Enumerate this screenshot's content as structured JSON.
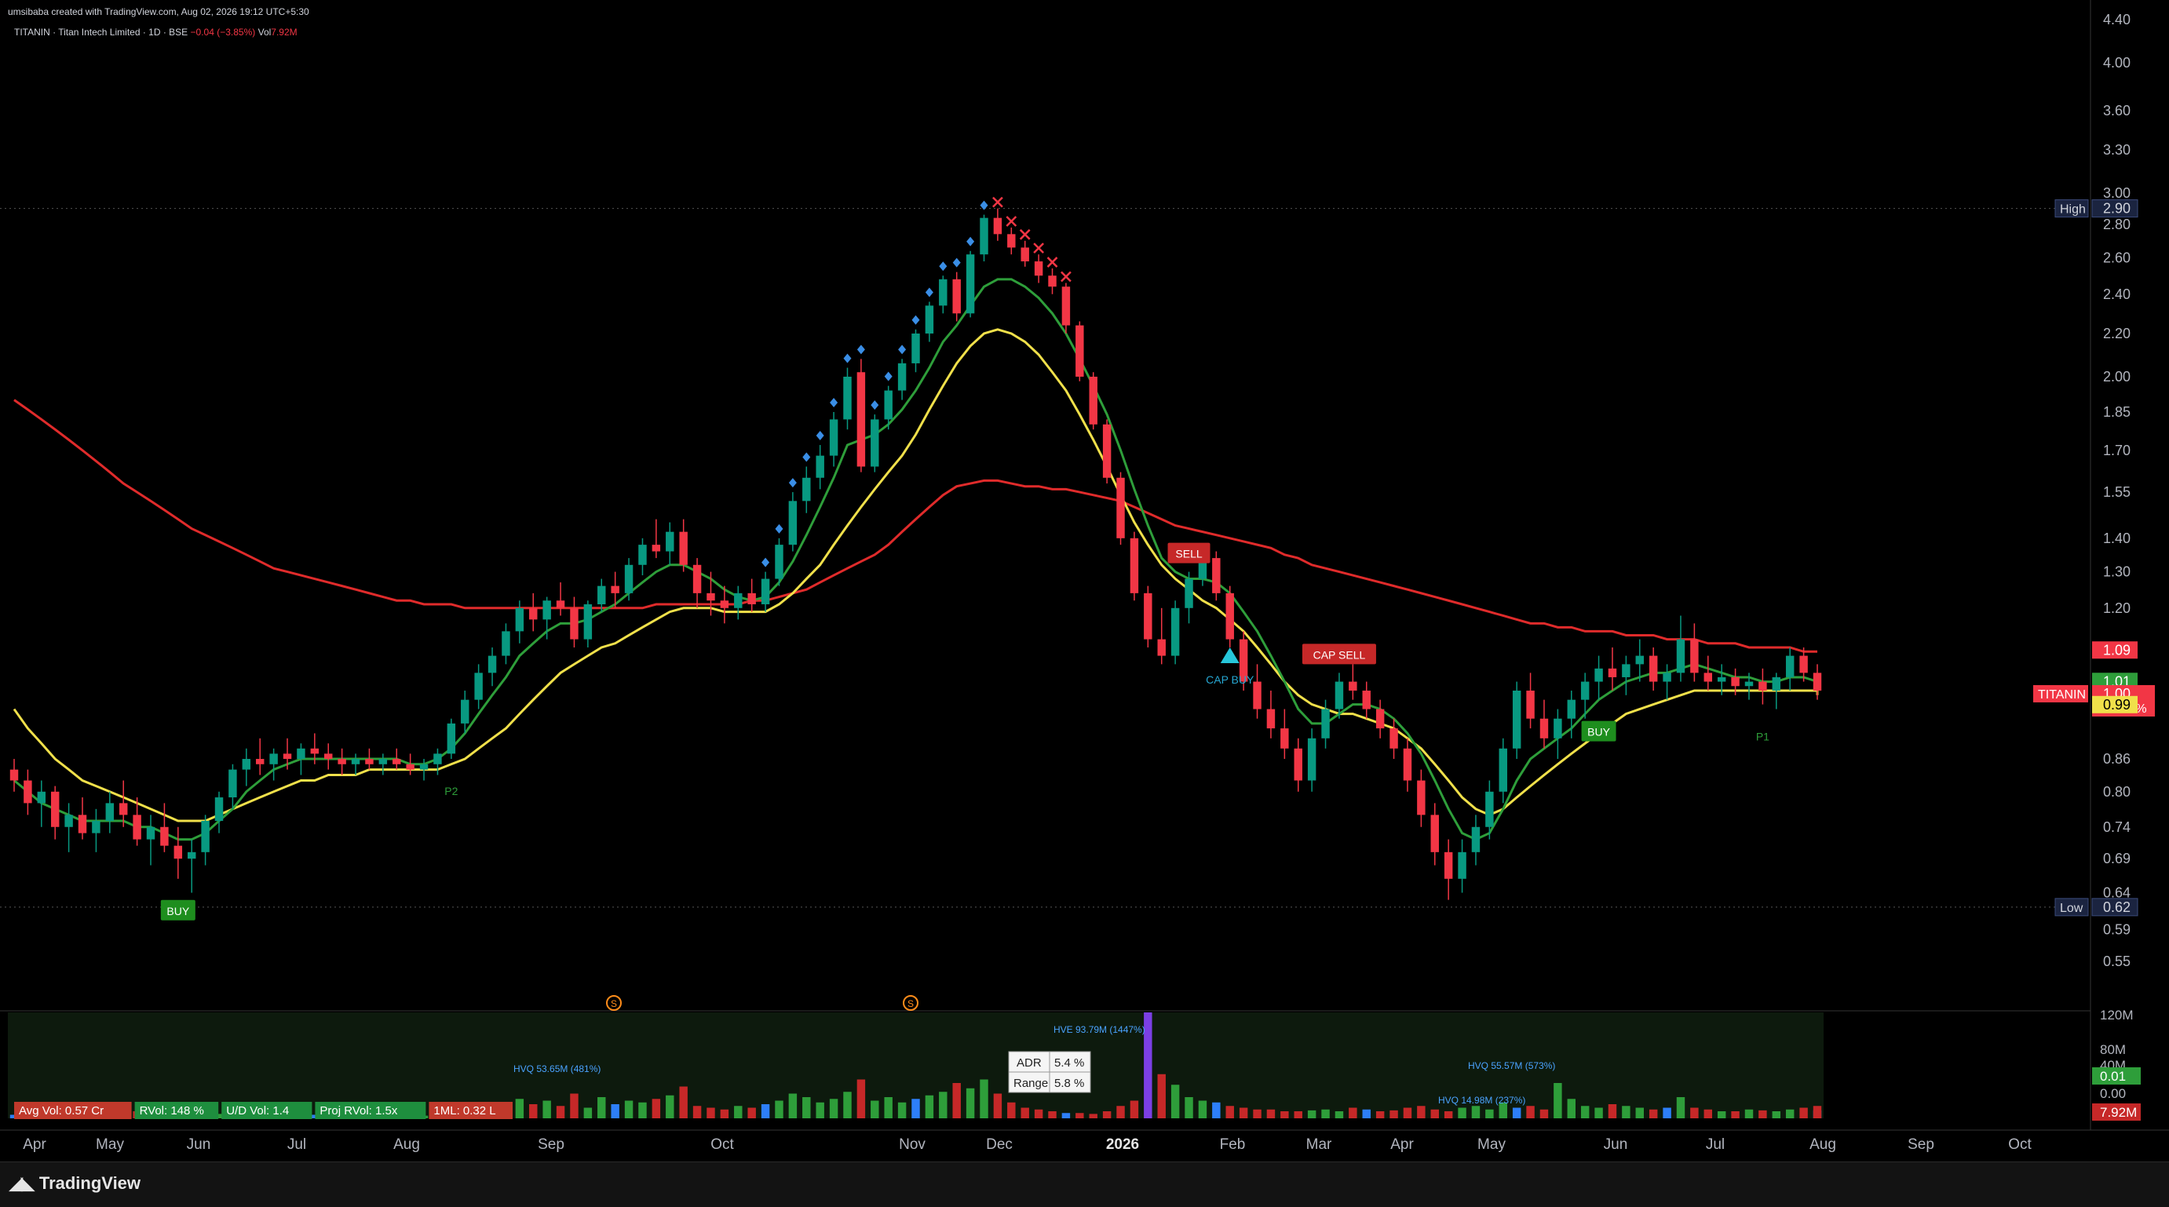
{
  "header": {
    "creator": "umsibaba created with TradingView.com, Aug 02, 2026 19:12 UTC+5:30",
    "symbol_line": "TITANIN · Titan Intech Limited · 1D · BSE",
    "change": "−0.04 (−3.85%)",
    "vol_label": "Vol",
    "vol_value": "7.92M"
  },
  "brand": {
    "name": "TradingView"
  },
  "colors": {
    "background": "#000000",
    "up": "#089981",
    "down": "#f23645",
    "ma_fast": "#2e9e3a",
    "ma_mid": "#f0e04a",
    "ma_slow": "#e02b2b",
    "diamond": "#3a8ee6",
    "price_label": "#f23645"
  },
  "chart_data": {
    "type": "candlestick",
    "symbol": "TITANIN",
    "timeframe": "1D",
    "y_scale": "log",
    "y_range": [
      0.5,
      4.4
    ],
    "y_ticks": [
      "4.40",
      "4.00",
      "3.60",
      "3.30",
      "3.00",
      "2.80",
      "2.60",
      "2.40",
      "2.20",
      "2.00",
      "1.85",
      "1.70",
      "1.55",
      "1.40",
      "1.30",
      "1.20",
      "1.09",
      "1.01",
      "1.00",
      "0.99",
      "0.86",
      "0.80",
      "0.74",
      "0.69",
      "0.64",
      "0.59",
      "0.55"
    ],
    "x_labels": [
      "Apr",
      "May",
      "Jun",
      "Jul",
      "Aug",
      "Sep",
      "Oct",
      "Nov",
      "Dec",
      "2026",
      "Feb",
      "Mar",
      "Apr",
      "May",
      "Jun",
      "Jul",
      "Aug",
      "Sep",
      "Oct"
    ],
    "high": {
      "label": "High",
      "value": "2.90"
    },
    "low": {
      "label": "Low",
      "value": "0.62"
    },
    "price_labels": [
      {
        "value": "1.09",
        "color": "#f23645"
      },
      {
        "value": "1.01",
        "color": "#2e9e3a"
      },
      {
        "symbol": "TITANIN",
        "value": "1.00",
        "change": "+25.26%",
        "color": "#f23645"
      },
      {
        "value": "0.99",
        "color": "#f0e04a"
      }
    ],
    "candles": [
      [
        0.84,
        0.86,
        0.8,
        0.82
      ],
      [
        0.82,
        0.84,
        0.76,
        0.78
      ],
      [
        0.78,
        0.82,
        0.74,
        0.8
      ],
      [
        0.8,
        0.81,
        0.72,
        0.74
      ],
      [
        0.74,
        0.78,
        0.7,
        0.76
      ],
      [
        0.76,
        0.79,
        0.72,
        0.73
      ],
      [
        0.73,
        0.77,
        0.7,
        0.75
      ],
      [
        0.75,
        0.8,
        0.73,
        0.78
      ],
      [
        0.78,
        0.82,
        0.74,
        0.76
      ],
      [
        0.76,
        0.79,
        0.71,
        0.72
      ],
      [
        0.72,
        0.76,
        0.68,
        0.74
      ],
      [
        0.74,
        0.78,
        0.7,
        0.71
      ],
      [
        0.71,
        0.74,
        0.66,
        0.69
      ],
      [
        0.69,
        0.72,
        0.64,
        0.7
      ],
      [
        0.7,
        0.76,
        0.68,
        0.75
      ],
      [
        0.75,
        0.8,
        0.73,
        0.79
      ],
      [
        0.79,
        0.85,
        0.77,
        0.84
      ],
      [
        0.84,
        0.88,
        0.81,
        0.86
      ],
      [
        0.86,
        0.9,
        0.83,
        0.85
      ],
      [
        0.85,
        0.88,
        0.82,
        0.87
      ],
      [
        0.87,
        0.9,
        0.84,
        0.86
      ],
      [
        0.86,
        0.89,
        0.83,
        0.88
      ],
      [
        0.88,
        0.91,
        0.85,
        0.87
      ],
      [
        0.87,
        0.89,
        0.84,
        0.86
      ],
      [
        0.86,
        0.88,
        0.83,
        0.85
      ],
      [
        0.85,
        0.87,
        0.83,
        0.86
      ],
      [
        0.86,
        0.88,
        0.84,
        0.85
      ],
      [
        0.85,
        0.87,
        0.83,
        0.86
      ],
      [
        0.86,
        0.88,
        0.84,
        0.85
      ],
      [
        0.85,
        0.87,
        0.83,
        0.84
      ],
      [
        0.84,
        0.86,
        0.82,
        0.85
      ],
      [
        0.85,
        0.88,
        0.83,
        0.87
      ],
      [
        0.87,
        0.94,
        0.86,
        0.93
      ],
      [
        0.93,
        1.0,
        0.91,
        0.98
      ],
      [
        0.98,
        1.06,
        0.96,
        1.04
      ],
      [
        1.04,
        1.1,
        1.01,
        1.08
      ],
      [
        1.08,
        1.16,
        1.06,
        1.14
      ],
      [
        1.14,
        1.22,
        1.11,
        1.2
      ],
      [
        1.2,
        1.24,
        1.14,
        1.17
      ],
      [
        1.17,
        1.23,
        1.12,
        1.22
      ],
      [
        1.22,
        1.27,
        1.18,
        1.2
      ],
      [
        1.2,
        1.23,
        1.1,
        1.12
      ],
      [
        1.12,
        1.22,
        1.1,
        1.21
      ],
      [
        1.21,
        1.28,
        1.19,
        1.26
      ],
      [
        1.26,
        1.3,
        1.2,
        1.24
      ],
      [
        1.24,
        1.34,
        1.22,
        1.32
      ],
      [
        1.32,
        1.4,
        1.29,
        1.38
      ],
      [
        1.38,
        1.46,
        1.34,
        1.36
      ],
      [
        1.36,
        1.45,
        1.32,
        1.42
      ],
      [
        1.42,
        1.46,
        1.3,
        1.32
      ],
      [
        1.32,
        1.34,
        1.2,
        1.24
      ],
      [
        1.24,
        1.3,
        1.18,
        1.22
      ],
      [
        1.22,
        1.26,
        1.16,
        1.2
      ],
      [
        1.2,
        1.26,
        1.17,
        1.24
      ],
      [
        1.24,
        1.28,
        1.19,
        1.21
      ],
      [
        1.21,
        1.3,
        1.19,
        1.28
      ],
      [
        1.28,
        1.4,
        1.26,
        1.38
      ],
      [
        1.38,
        1.55,
        1.36,
        1.52
      ],
      [
        1.52,
        1.64,
        1.48,
        1.6
      ],
      [
        1.6,
        1.72,
        1.56,
        1.68
      ],
      [
        1.68,
        1.85,
        1.64,
        1.82
      ],
      [
        1.82,
        2.04,
        1.78,
        2.0
      ],
      [
        2.02,
        2.08,
        1.62,
        1.64
      ],
      [
        1.64,
        1.84,
        1.62,
        1.82
      ],
      [
        1.82,
        1.96,
        1.78,
        1.94
      ],
      [
        1.94,
        2.08,
        1.9,
        2.06
      ],
      [
        2.06,
        2.22,
        2.02,
        2.2
      ],
      [
        2.2,
        2.36,
        2.16,
        2.34
      ],
      [
        2.34,
        2.5,
        2.3,
        2.48
      ],
      [
        2.48,
        2.52,
        2.26,
        2.3
      ],
      [
        2.3,
        2.64,
        2.28,
        2.62
      ],
      [
        2.62,
        2.86,
        2.58,
        2.84
      ],
      [
        2.84,
        2.9,
        2.7,
        2.74
      ],
      [
        2.74,
        2.78,
        2.62,
        2.66
      ],
      [
        2.66,
        2.7,
        2.55,
        2.58
      ],
      [
        2.58,
        2.62,
        2.46,
        2.5
      ],
      [
        2.5,
        2.54,
        2.4,
        2.44
      ],
      [
        2.44,
        2.46,
        2.2,
        2.24
      ],
      [
        2.24,
        2.26,
        1.98,
        2.0
      ],
      [
        2.0,
        2.02,
        1.78,
        1.8
      ],
      [
        1.8,
        1.82,
        1.58,
        1.6
      ],
      [
        1.6,
        1.62,
        1.38,
        1.4
      ],
      [
        1.4,
        1.42,
        1.22,
        1.24
      ],
      [
        1.24,
        1.26,
        1.1,
        1.12
      ],
      [
        1.12,
        1.2,
        1.06,
        1.08
      ],
      [
        1.08,
        1.22,
        1.06,
        1.2
      ],
      [
        1.2,
        1.3,
        1.16,
        1.28
      ],
      [
        1.28,
        1.36,
        1.26,
        1.34
      ],
      [
        1.34,
        1.36,
        1.22,
        1.24
      ],
      [
        1.24,
        1.26,
        1.1,
        1.12
      ],
      [
        1.12,
        1.14,
        1.0,
        1.02
      ],
      [
        1.02,
        1.06,
        0.94,
        0.96
      ],
      [
        0.96,
        1.0,
        0.9,
        0.92
      ],
      [
        0.92,
        0.96,
        0.86,
        0.88
      ],
      [
        0.88,
        0.9,
        0.8,
        0.82
      ],
      [
        0.82,
        0.92,
        0.8,
        0.9
      ],
      [
        0.9,
        0.98,
        0.88,
        0.96
      ],
      [
        0.96,
        1.04,
        0.94,
        1.02
      ],
      [
        1.02,
        1.06,
        0.98,
        1.0
      ],
      [
        1.0,
        1.02,
        0.94,
        0.96
      ],
      [
        0.96,
        0.98,
        0.9,
        0.92
      ],
      [
        0.92,
        0.94,
        0.86,
        0.88
      ],
      [
        0.88,
        0.9,
        0.8,
        0.82
      ],
      [
        0.82,
        0.84,
        0.74,
        0.76
      ],
      [
        0.76,
        0.78,
        0.68,
        0.7
      ],
      [
        0.7,
        0.72,
        0.63,
        0.66
      ],
      [
        0.66,
        0.72,
        0.64,
        0.7
      ],
      [
        0.7,
        0.76,
        0.68,
        0.74
      ],
      [
        0.74,
        0.82,
        0.72,
        0.8
      ],
      [
        0.8,
        0.9,
        0.78,
        0.88
      ],
      [
        0.88,
        1.02,
        0.86,
        1.0
      ],
      [
        1.0,
        1.04,
        0.92,
        0.94
      ],
      [
        0.94,
        0.98,
        0.88,
        0.9
      ],
      [
        0.9,
        0.96,
        0.86,
        0.94
      ],
      [
        0.94,
        1.0,
        0.9,
        0.98
      ],
      [
        0.98,
        1.04,
        0.94,
        1.02
      ],
      [
        1.02,
        1.08,
        0.98,
        1.05
      ],
      [
        1.05,
        1.1,
        1.0,
        1.03
      ],
      [
        1.03,
        1.08,
        0.99,
        1.06
      ],
      [
        1.06,
        1.12,
        1.02,
        1.08
      ],
      [
        1.08,
        1.1,
        1.0,
        1.02
      ],
      [
        1.02,
        1.06,
        0.98,
        1.04
      ],
      [
        1.04,
        1.18,
        1.02,
        1.12
      ],
      [
        1.12,
        1.16,
        1.02,
        1.04
      ],
      [
        1.04,
        1.08,
        1.0,
        1.02
      ],
      [
        1.02,
        1.06,
        0.99,
        1.03
      ],
      [
        1.03,
        1.05,
        0.99,
        1.01
      ],
      [
        1.01,
        1.04,
        0.98,
        1.02
      ],
      [
        1.02,
        1.05,
        0.97,
        1.0
      ],
      [
        1.0,
        1.04,
        0.96,
        1.03
      ],
      [
        1.03,
        1.1,
        1.0,
        1.08
      ],
      [
        1.08,
        1.1,
        1.02,
        1.04
      ],
      [
        1.04,
        1.06,
        0.98,
        1.0
      ]
    ],
    "ma_fast": [
      0.82,
      0.8,
      0.78,
      0.77,
      0.76,
      0.75,
      0.75,
      0.75,
      0.75,
      0.74,
      0.74,
      0.73,
      0.72,
      0.72,
      0.73,
      0.75,
      0.77,
      0.8,
      0.82,
      0.84,
      0.85,
      0.86,
      0.86,
      0.86,
      0.86,
      0.86,
      0.86,
      0.86,
      0.86,
      0.85,
      0.85,
      0.86,
      0.88,
      0.91,
      0.95,
      0.99,
      1.03,
      1.08,
      1.11,
      1.14,
      1.16,
      1.16,
      1.17,
      1.19,
      1.21,
      1.24,
      1.27,
      1.3,
      1.32,
      1.32,
      1.3,
      1.28,
      1.25,
      1.23,
      1.22,
      1.23,
      1.27,
      1.33,
      1.41,
      1.5,
      1.6,
      1.72,
      1.74,
      1.76,
      1.8,
      1.86,
      1.94,
      2.04,
      2.16,
      2.24,
      2.34,
      2.44,
      2.48,
      2.48,
      2.44,
      2.38,
      2.3,
      2.2,
      2.08,
      1.96,
      1.84,
      1.7,
      1.56,
      1.44,
      1.34,
      1.3,
      1.28,
      1.28,
      1.27,
      1.24,
      1.19,
      1.14,
      1.08,
      1.02,
      0.96,
      0.93,
      0.93,
      0.95,
      0.97,
      0.97,
      0.96,
      0.94,
      0.91,
      0.87,
      0.82,
      0.77,
      0.73,
      0.72,
      0.73,
      0.77,
      0.82,
      0.86,
      0.88,
      0.9,
      0.92,
      0.95,
      0.98,
      1.0,
      1.02,
      1.03,
      1.04,
      1.04,
      1.05,
      1.06,
      1.05,
      1.04,
      1.03,
      1.03,
      1.02,
      1.02,
      1.03,
      1.03,
      1.02,
      1.01
    ],
    "ma_mid": [
      0.96,
      0.92,
      0.89,
      0.86,
      0.84,
      0.82,
      0.81,
      0.8,
      0.79,
      0.78,
      0.77,
      0.76,
      0.75,
      0.75,
      0.75,
      0.76,
      0.77,
      0.78,
      0.79,
      0.8,
      0.81,
      0.82,
      0.82,
      0.83,
      0.83,
      0.83,
      0.84,
      0.84,
      0.84,
      0.84,
      0.84,
      0.84,
      0.85,
      0.86,
      0.88,
      0.9,
      0.92,
      0.95,
      0.98,
      1.01,
      1.04,
      1.06,
      1.08,
      1.1,
      1.11,
      1.13,
      1.15,
      1.17,
      1.19,
      1.2,
      1.2,
      1.2,
      1.19,
      1.19,
      1.19,
      1.19,
      1.21,
      1.24,
      1.28,
      1.32,
      1.38,
      1.44,
      1.5,
      1.56,
      1.62,
      1.68,
      1.76,
      1.86,
      1.96,
      2.06,
      2.14,
      2.2,
      2.22,
      2.2,
      2.16,
      2.1,
      2.02,
      1.94,
      1.84,
      1.74,
      1.64,
      1.54,
      1.45,
      1.38,
      1.32,
      1.28,
      1.25,
      1.22,
      1.2,
      1.17,
      1.14,
      1.1,
      1.06,
      1.02,
      0.99,
      0.97,
      0.96,
      0.95,
      0.95,
      0.94,
      0.93,
      0.92,
      0.9,
      0.88,
      0.85,
      0.82,
      0.79,
      0.77,
      0.76,
      0.77,
      0.79,
      0.81,
      0.83,
      0.85,
      0.87,
      0.89,
      0.91,
      0.93,
      0.95,
      0.96,
      0.97,
      0.98,
      0.99,
      1.0,
      1.0,
      1.0,
      1.0,
      1.0,
      1.0,
      1.0,
      1.0,
      1.0,
      1.0,
      0.99
    ],
    "ma_slow": [
      1.9,
      1.86,
      1.82,
      1.78,
      1.74,
      1.7,
      1.66,
      1.62,
      1.58,
      1.55,
      1.52,
      1.49,
      1.46,
      1.43,
      1.41,
      1.39,
      1.37,
      1.35,
      1.33,
      1.31,
      1.3,
      1.29,
      1.28,
      1.27,
      1.26,
      1.25,
      1.24,
      1.23,
      1.22,
      1.22,
      1.21,
      1.21,
      1.21,
      1.2,
      1.2,
      1.2,
      1.2,
      1.2,
      1.2,
      1.2,
      1.2,
      1.2,
      1.2,
      1.2,
      1.2,
      1.2,
      1.2,
      1.21,
      1.21,
      1.21,
      1.21,
      1.21,
      1.21,
      1.21,
      1.22,
      1.22,
      1.23,
      1.24,
      1.25,
      1.27,
      1.29,
      1.31,
      1.33,
      1.35,
      1.38,
      1.42,
      1.46,
      1.5,
      1.54,
      1.57,
      1.58,
      1.59,
      1.59,
      1.58,
      1.57,
      1.57,
      1.56,
      1.56,
      1.55,
      1.54,
      1.53,
      1.52,
      1.5,
      1.48,
      1.46,
      1.44,
      1.43,
      1.42,
      1.41,
      1.4,
      1.39,
      1.38,
      1.37,
      1.35,
      1.34,
      1.32,
      1.31,
      1.3,
      1.29,
      1.28,
      1.27,
      1.26,
      1.25,
      1.24,
      1.23,
      1.22,
      1.21,
      1.2,
      1.19,
      1.18,
      1.17,
      1.16,
      1.16,
      1.15,
      1.15,
      1.14,
      1.14,
      1.14,
      1.13,
      1.13,
      1.13,
      1.12,
      1.12,
      1.12,
      1.11,
      1.11,
      1.11,
      1.1,
      1.1,
      1.1,
      1.1,
      1.09,
      1.09,
      1.09
    ],
    "signals": [
      {
        "text": "BUY",
        "bar": 12,
        "type": "buy",
        "pos": "below"
      },
      {
        "text": "P2",
        "bar": 32,
        "type": "p",
        "pos": "below"
      },
      {
        "text": "SELL",
        "bar": 86,
        "type": "sell",
        "pos": "above"
      },
      {
        "text": "CAP BUY",
        "bar": 89,
        "type": "capbuy",
        "pos": "below"
      },
      {
        "text": "CAP SELL",
        "bar": 97,
        "type": "capsell",
        "pos": "above"
      },
      {
        "text": "BUY",
        "bar": 116,
        "type": "buy",
        "pos": "below"
      },
      {
        "text": "P1",
        "bar": 128,
        "type": "p",
        "pos": "below"
      }
    ],
    "volume_panel": {
      "axis_labels": [
        "120M",
        "80M",
        "40M",
        "0.01",
        "0.00",
        "7.92M"
      ],
      "stats": [
        {
          "text": "Avg Vol: 0.57 Cr",
          "color": "#c0392b"
        },
        {
          "text": "RVol: 148 %",
          "color": "#1e8e3e"
        },
        {
          "text": "U/D Vol: 1.4",
          "color": "#1e8e3e"
        },
        {
          "text": "Proj RVol: 1.5x",
          "color": "#1e8e3e"
        },
        {
          "text": "1ML: 0.32 L",
          "color": "#c0392b"
        }
      ],
      "adr": {
        "label": "ADR",
        "value": "5.4 %"
      },
      "range": {
        "label": "Range",
        "value": "5.8 %"
      },
      "hv_labels": [
        "HVQ 53.65M (481%)",
        "HVE 93.79M (1447%)",
        "HVQ 55.57M (573%)",
        "HVQ 14.98M (237%)"
      ],
      "volumes": [
        4,
        3,
        5,
        6,
        3,
        4,
        5,
        3,
        6,
        8,
        5,
        4,
        7,
        9,
        6,
        5,
        8,
        4,
        3,
        5,
        4,
        3,
        4,
        3,
        2,
        3,
        4,
        3,
        2,
        3,
        3,
        4,
        10,
        14,
        16,
        12,
        18,
        22,
        16,
        20,
        14,
        28,
        12,
        24,
        16,
        20,
        18,
        22,
        26,
        36,
        14,
        12,
        10,
        14,
        12,
        16,
        20,
        28,
        24,
        18,
        22,
        30,
        44,
        20,
        24,
        18,
        22,
        26,
        30,
        40,
        34,
        44,
        28,
        18,
        12,
        10,
        8,
        6,
        6,
        5,
        8,
        14,
        20,
        120,
        50,
        38,
        24,
        20,
        18,
        14,
        12,
        10,
        10,
        8,
        8,
        9,
        10,
        8,
        12,
        10,
        8,
        9,
        12,
        14,
        10,
        8,
        12,
        14,
        10,
        18,
        12,
        14,
        10,
        40,
        22,
        14,
        12,
        16,
        14,
        12,
        10,
        12,
        24,
        12,
        10,
        8,
        8,
        10,
        9,
        8,
        10,
        12,
        9,
        14
      ],
      "vol_colors": "mixed"
    }
  }
}
